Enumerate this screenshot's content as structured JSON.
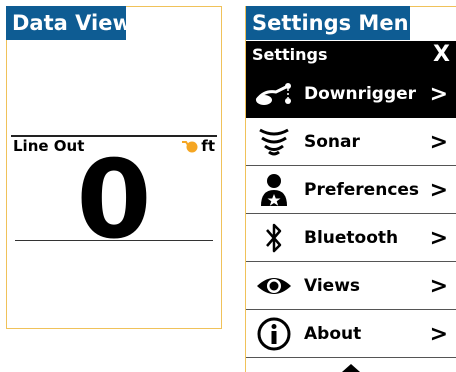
{
  "data_view": {
    "caption": "Data View",
    "label": "Line Out",
    "units": "ft",
    "value": "0",
    "units_icon": "downrigger-ball-icon",
    "accent_color": "#f5a623"
  },
  "settings_menu": {
    "caption": "Settings Menu",
    "title": "Settings",
    "close_label": "X",
    "items": [
      {
        "label": "Downrigger",
        "icon": "downrigger-icon",
        "chevron": ">",
        "selected": true
      },
      {
        "label": "Sonar",
        "icon": "sonar-icon",
        "chevron": ">"
      },
      {
        "label": "Preferences",
        "icon": "user-star-icon",
        "chevron": ">"
      },
      {
        "label": "Bluetooth",
        "icon": "bluetooth-icon",
        "chevron": ">"
      },
      {
        "label": "Views",
        "icon": "eye-icon",
        "chevron": ">"
      },
      {
        "label": "About",
        "icon": "info-icon",
        "chevron": ">"
      }
    ],
    "more_indicator": "chevron-up-icon"
  },
  "colors": {
    "caption_bg": "#0e5c93",
    "panel_border": "#f0c25a",
    "selected_bg": "#000000"
  }
}
